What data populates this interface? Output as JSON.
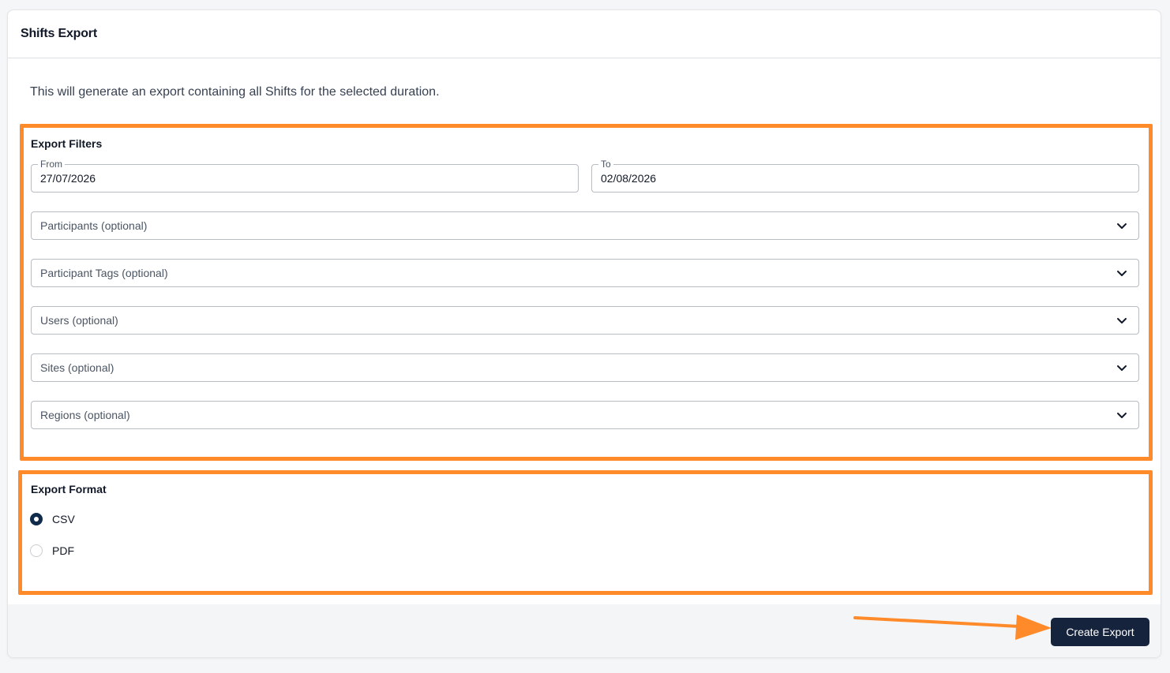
{
  "header": {
    "title": "Shifts Export"
  },
  "description": "This will generate an export containing all Shifts for the selected duration.",
  "filters": {
    "heading": "Export Filters",
    "from": {
      "label": "From",
      "value": "27/07/2026"
    },
    "to": {
      "label": "To",
      "value": "02/08/2026"
    },
    "selects": [
      {
        "placeholder": "Participants (optional)"
      },
      {
        "placeholder": "Participant Tags (optional)"
      },
      {
        "placeholder": "Users (optional)"
      },
      {
        "placeholder": "Sites (optional)"
      },
      {
        "placeholder": "Regions (optional)"
      }
    ]
  },
  "format": {
    "heading": "Export Format",
    "options": [
      {
        "label": "CSV",
        "checked": true
      },
      {
        "label": "PDF",
        "checked": false
      }
    ]
  },
  "footer": {
    "create_label": "Create Export"
  },
  "colors": {
    "highlight": "#ff8a2a",
    "primary_button": "#16233d",
    "radio_checked": "#0f2a4a"
  },
  "icons": {
    "select_chevron": "chevron-down-icon",
    "annotation_arrow": "arrow-right-icon"
  }
}
